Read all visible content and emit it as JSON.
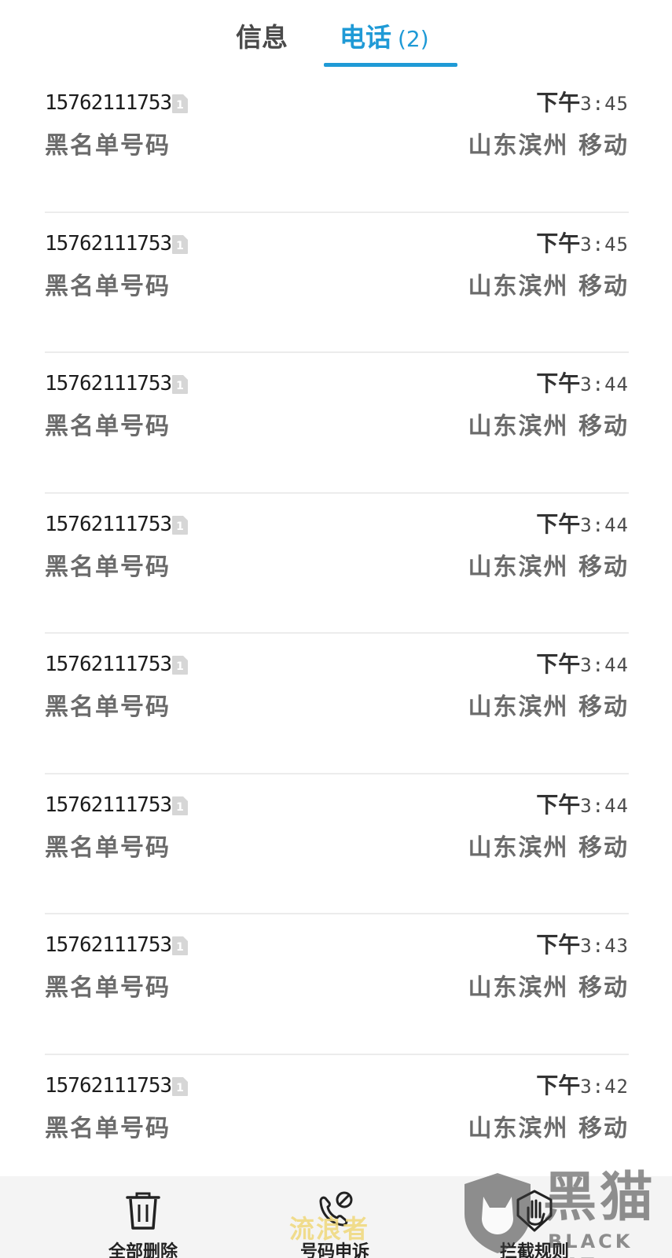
{
  "tabs": {
    "messages": {
      "label": "信息"
    },
    "calls": {
      "label": "电话",
      "count": "(2)"
    }
  },
  "calls": [
    {
      "number": "15762111753",
      "sim": "1",
      "label": "黑名单号码",
      "time_prefix": "下午",
      "time": "3:45",
      "location": "山东滨州 移动"
    },
    {
      "number": "15762111753",
      "sim": "1",
      "label": "黑名单号码",
      "time_prefix": "下午",
      "time": "3:45",
      "location": "山东滨州 移动"
    },
    {
      "number": "15762111753",
      "sim": "1",
      "label": "黑名单号码",
      "time_prefix": "下午",
      "time": "3:44",
      "location": "山东滨州 移动"
    },
    {
      "number": "15762111753",
      "sim": "1",
      "label": "黑名单号码",
      "time_prefix": "下午",
      "time": "3:44",
      "location": "山东滨州 移动"
    },
    {
      "number": "15762111753",
      "sim": "1",
      "label": "黑名单号码",
      "time_prefix": "下午",
      "time": "3:44",
      "location": "山东滨州 移动"
    },
    {
      "number": "15762111753",
      "sim": "1",
      "label": "黑名单号码",
      "time_prefix": "下午",
      "time": "3:44",
      "location": "山东滨州 移动"
    },
    {
      "number": "15762111753",
      "sim": "1",
      "label": "黑名单号码",
      "time_prefix": "下午",
      "time": "3:43",
      "location": "山东滨州 移动"
    },
    {
      "number": "15762111753",
      "sim": "1",
      "label": "黑名单号码",
      "time_prefix": "下午",
      "time": "3:42",
      "location": "山东滨州 移动"
    }
  ],
  "toolbar": {
    "delete_all": {
      "label": "全部删除",
      "icon": "trash-icon"
    },
    "report": {
      "label": "号码申诉",
      "icon": "phone-block-icon"
    },
    "rules": {
      "label": "拦截规则",
      "icon": "hand-stop-icon"
    }
  },
  "watermark": {
    "text": "流浪者",
    "logo_cn": "黑猫",
    "logo_en": "BLACK CAT"
  },
  "colors": {
    "accent": "#1f9ad6",
    "text_primary": "#1c1c1c",
    "text_secondary": "#6b6b6b",
    "divider": "#ececec"
  }
}
